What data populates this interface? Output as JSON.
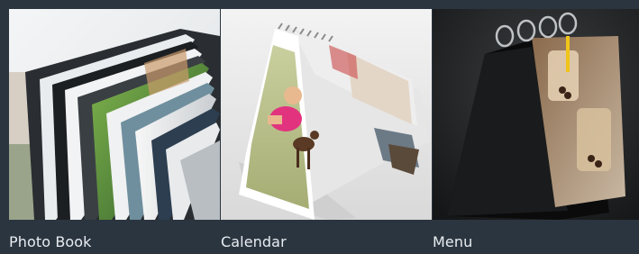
{
  "gallery": {
    "items": [
      {
        "label": "Photo Book",
        "icon": "photo-book-image"
      },
      {
        "label": "Calendar",
        "icon": "calendar-image"
      },
      {
        "label": "Menu",
        "icon": "menu-stand-image"
      }
    ]
  },
  "colors": {
    "background": "#2b3540",
    "caption_text": "#e9edf1"
  }
}
